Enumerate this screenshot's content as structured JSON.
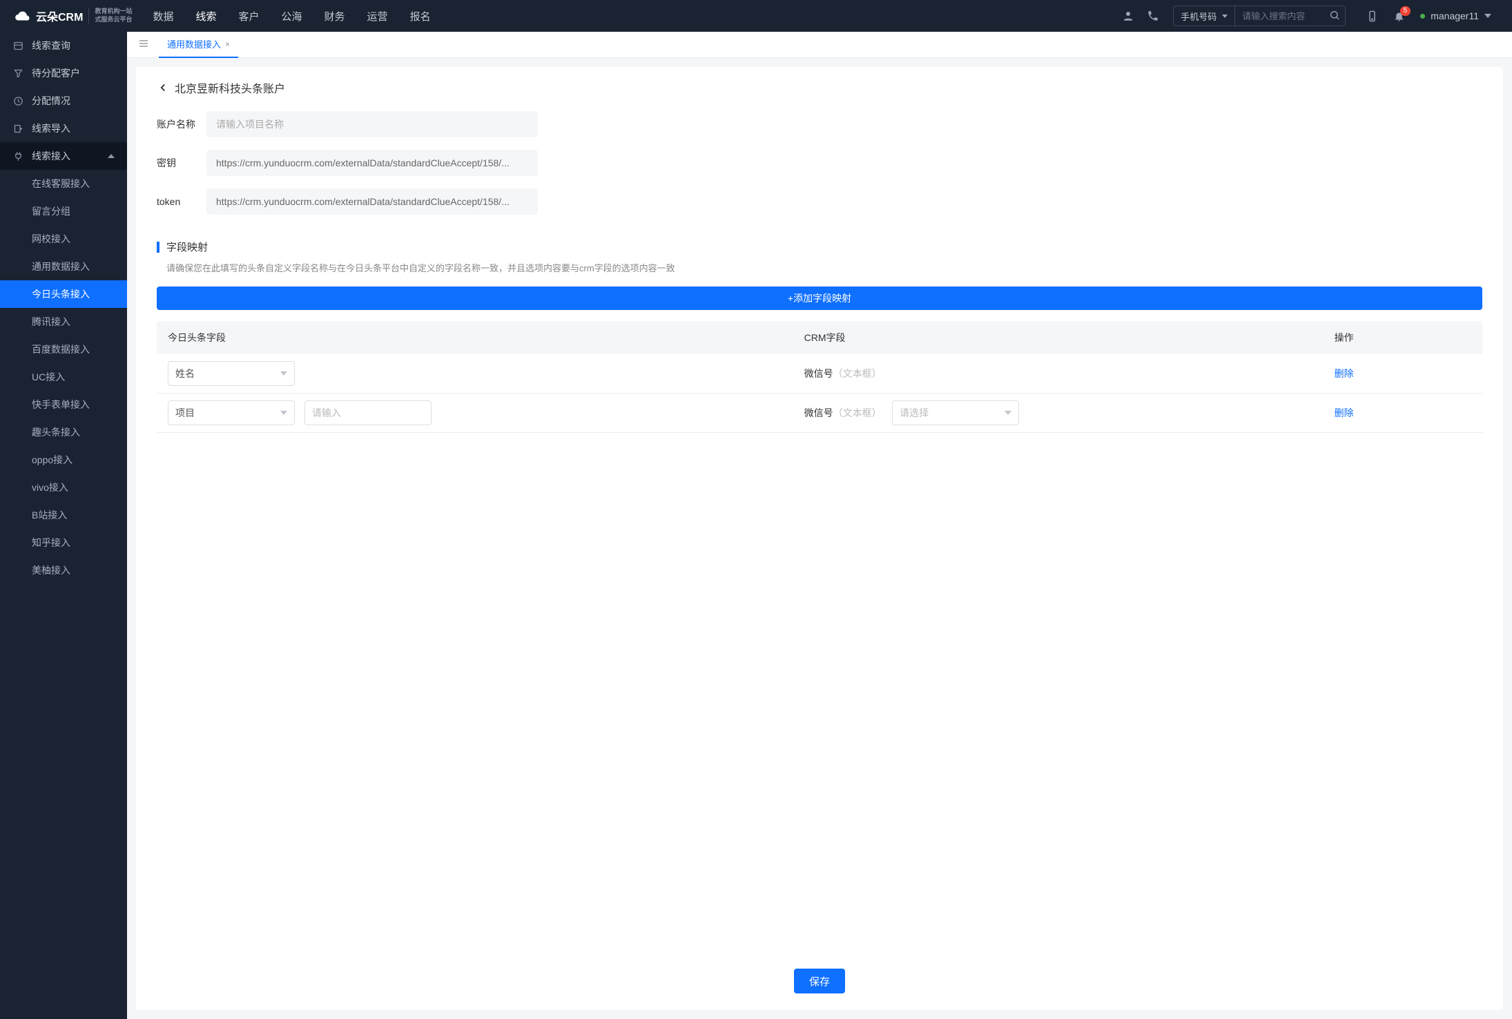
{
  "header": {
    "logo_text": "云朵CRM",
    "logo_sub1": "教育机构一站",
    "logo_sub2": "式服务云平台",
    "nav": [
      "数据",
      "线索",
      "客户",
      "公海",
      "财务",
      "运营",
      "报名"
    ],
    "nav_active": 1,
    "search_type": "手机号码",
    "search_placeholder": "请输入搜索内容",
    "notification_count": "5",
    "user": "manager11"
  },
  "sidebar": {
    "items": [
      {
        "label": "线索查询",
        "icon": "list"
      },
      {
        "label": "待分配客户",
        "icon": "filter"
      },
      {
        "label": "分配情况",
        "icon": "clock"
      },
      {
        "label": "线索导入",
        "icon": "export"
      },
      {
        "label": "线索接入",
        "icon": "plug",
        "expanded": true
      }
    ],
    "sub_items": [
      {
        "label": "在线客服接入"
      },
      {
        "label": "留言分组"
      },
      {
        "label": "网校接入"
      },
      {
        "label": "通用数据接入"
      },
      {
        "label": "今日头条接入",
        "active": true
      },
      {
        "label": "腾讯接入"
      },
      {
        "label": "百度数据接入"
      },
      {
        "label": "UC接入"
      },
      {
        "label": "快手表单接入"
      },
      {
        "label": "趣头条接入"
      },
      {
        "label": "oppo接入"
      },
      {
        "label": "vivo接入"
      },
      {
        "label": "B站接入"
      },
      {
        "label": "知乎接入"
      },
      {
        "label": "美柚接入"
      }
    ]
  },
  "tabs": [
    {
      "label": "通用数据接入",
      "active": true
    }
  ],
  "page": {
    "title": "北京昱新科技头条账户",
    "form": {
      "name_label": "账户名称",
      "name_placeholder": "请输入项目名称",
      "secret_label": "密钥",
      "secret_value": "https://crm.yunduocrm.com/externalData/standardClueAccept/158/...",
      "token_label": "token",
      "token_value": "https://crm.yunduocrm.com/externalData/standardClueAccept/158/..."
    },
    "mapping": {
      "section_title": "字段映射",
      "hint": "请确保您在此填写的头条自定义字段名称与在今日头条平台中自定义的字段名称一致，并且选项内容要与crm字段的选项内容一致",
      "add_button": "+添加字段映射",
      "col1": "今日头条字段",
      "col2": "CRM字段",
      "col3": "操作",
      "rows": [
        {
          "field": "姓名",
          "crm_label": "微信号",
          "crm_hint": "（文本框）",
          "delete": "删除"
        },
        {
          "field": "项目",
          "sub_placeholder": "请输入",
          "crm_label": "微信号",
          "crm_hint": "（文本框）",
          "select_placeholder": "请选择",
          "delete": "删除"
        }
      ]
    },
    "save": "保存"
  }
}
